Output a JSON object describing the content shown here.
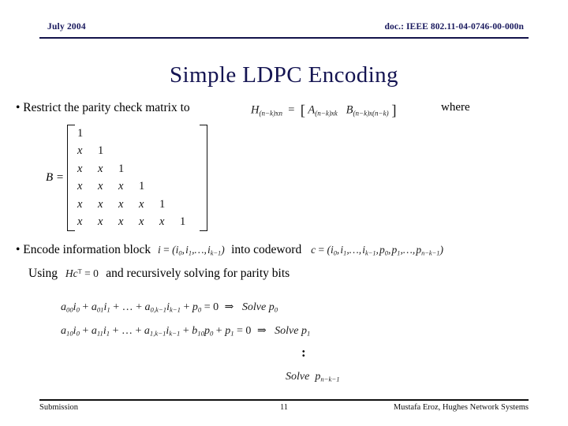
{
  "slide": {
    "header": {
      "date": "July 2004",
      "doc_ref": "doc.: IEEE 802.11-04-0746-00-000n"
    },
    "title": "Simple LDPC Encoding",
    "bullet1": {
      "text": "• Restrict the parity check matrix to",
      "where_label": "where",
      "equation": {
        "H": "H",
        "H_sub": "(n−k)xn",
        "equals": "=",
        "open_bracket": "[",
        "A": "A",
        "A_sub": "(n−k)xk",
        "B": "B",
        "B_sub": "(n−k)x(n−k)",
        "close_bracket": "]"
      }
    },
    "b_matrix": {
      "label": "B =",
      "rows": [
        [
          "1",
          "",
          "",
          "",
          "",
          ""
        ],
        [
          "x",
          "1",
          "",
          "",
          "",
          ""
        ],
        [
          "x",
          "x",
          "1",
          "",
          "",
          ""
        ],
        [
          "x",
          "x",
          "x",
          "1",
          "",
          ""
        ],
        [
          "x",
          "x",
          "x",
          "x",
          "1",
          ""
        ],
        [
          "x",
          "x",
          "x",
          "x",
          "x",
          "1"
        ]
      ]
    },
    "bullet2": {
      "prefix": "• Encode information block",
      "info_block_eq": {
        "lhs": "i",
        "equals": "=",
        "rhs": "(i0, i1,…, ik−1)"
      },
      "middle": "into codeword",
      "codeword_eq": {
        "lhs": "c",
        "equals": "=",
        "rhs": "(i0, i1,…, ik−1, p0, p1,…, pn−k−1)"
      }
    },
    "using_line": {
      "prefix": "Using",
      "equation": "Hc T = 0",
      "suffix": "and recursively solving for parity bits"
    },
    "recursion": {
      "line1": {
        "expression": "a00 i0 + a01 i1 + … + a0,k−1 ik−1 + p0 = 0",
        "arrow": "⇒",
        "solve": "Solve p0"
      },
      "line2": {
        "expression": "a10 i0 + a11 i1 + … + a1,k−1 ik−1 + b10 p0 + p1 = 0",
        "arrow": "⇒",
        "solve": "Solve p1"
      },
      "vdots": ":",
      "last": {
        "solve": "Solve",
        "variable": "pn−k−1"
      }
    },
    "footer": {
      "left": "Submission",
      "page": "11",
      "right": "Mustafa Eroz, Hughes Network Systems"
    },
    "colors": {
      "header_navy": "#1a1a5e",
      "title_navy": "#141452",
      "rule_dark": "#101010",
      "background": "#ffffff"
    }
  }
}
